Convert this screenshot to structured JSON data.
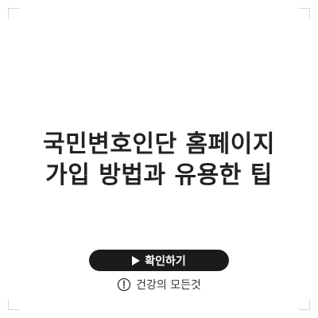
{
  "card": {
    "title_line1": "국민변호인단 홈페이지",
    "title_line2": "가입 방법과 유용한 팁",
    "confirm_label": "확인하기",
    "brand_name": "건강의 모든것"
  },
  "icons": {
    "confirm": "play-icon",
    "brand": "exclamation-circle-icon"
  },
  "colors": {
    "title": "#222222",
    "button_bg": "#1b1b1b",
    "button_text": "#ffffff",
    "corner_marks": "#d6d6d6"
  }
}
